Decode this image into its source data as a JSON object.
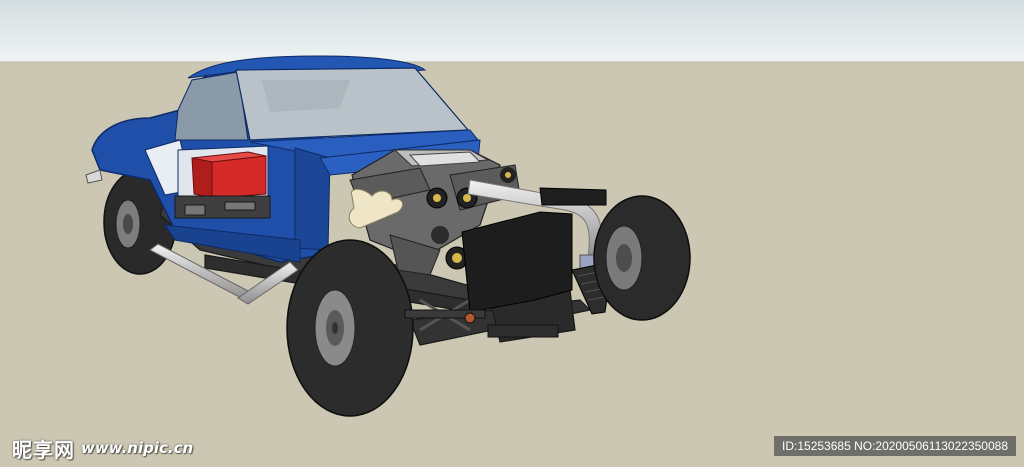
{
  "scene": {
    "description_colors": {
      "sky_top": "#d9e2e4",
      "sky_bottom": "#eef2f2",
      "ground": "#cbc6b1",
      "body_blue": "#1f4fa8",
      "body_blue_dark": "#163c86",
      "tire": "#2b2b2b",
      "engine_red": "#d42a28",
      "chrome": "#c9c9c9"
    }
  },
  "watermark": {
    "logo_text": "昵享网",
    "url_text": "www.nipic.cn",
    "id_text": "ID:15253685 NO:20200506113022350088"
  }
}
